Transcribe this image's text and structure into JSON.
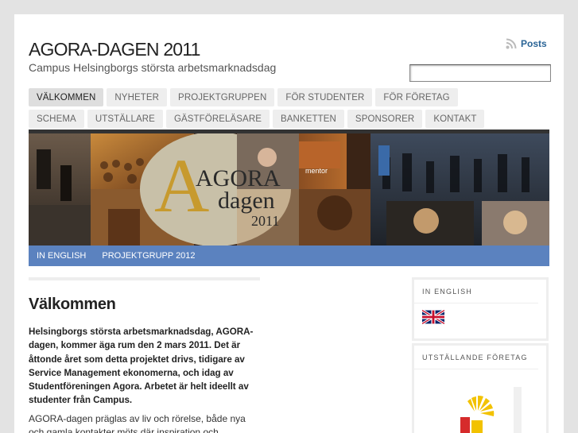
{
  "site": {
    "title": "AGORA-DAGEN 2011",
    "description": "Campus Helsingborgs största arbetsmarknadsdag"
  },
  "header": {
    "posts_label": "Posts",
    "rss_icon": "rss-icon",
    "search_value": ""
  },
  "nav": {
    "items": [
      "VÄLKOMMEN",
      "NYHETER",
      "PROJEKTGRUPPEN",
      "FÖR STUDENTER",
      "FÖR FÖRETAG",
      "SCHEMA",
      "UTSTÄLLARE",
      "GÄSTFÖRELÄSARE",
      "BANKETTEN",
      "SPONSORER",
      "KONTAKT"
    ],
    "active_index": 0
  },
  "banner": {
    "logo_line1": "AGORA",
    "logo_line2": "dagen",
    "logo_year": "2011",
    "poster_text": "mentor"
  },
  "subnav": {
    "items": [
      "IN ENGLISH",
      "PROJEKTGRUPP 2012"
    ]
  },
  "post": {
    "title": "Välkommen",
    "paragraph1": "Helsingborgs största arbetsmarknadsdag, AGORA-dagen, kommer äga rum den 2 mars 2011. Det är åttonde året som detta projektet drivs, tidigare av Service Management ekonomerna, och idag av Studentföreningen Agora. Arbetet är helt ideellt av studenter från Campus.",
    "paragraph2": "AGORA-dagen präglas av liv och rörelse, både nya och gamla kontakter möts där inspiration och"
  },
  "sidebar": {
    "widget1_title": "IN ENGLISH",
    "widget1_icon": "uk-flag-icon",
    "widget2_title": "UTSTÄLLANDE FÖRETAG",
    "widget2_icon": "exhibitor-logo-icon"
  },
  "colors": {
    "accent_blue": "#5b82bf",
    "link_blue": "#2a6496",
    "logo_gold": "#c79a2e"
  }
}
